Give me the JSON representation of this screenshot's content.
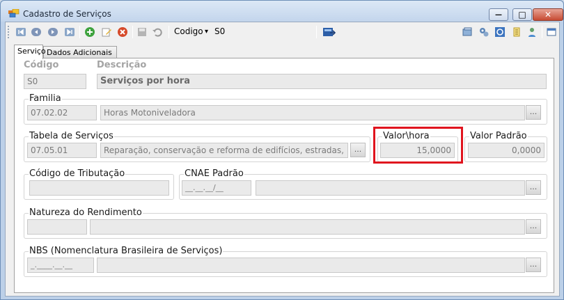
{
  "window": {
    "title": "Cadastro de Serviços",
    "controls": {
      "minimize": "—",
      "maximize": "□",
      "close": "✕"
    }
  },
  "toolbar": {
    "field_label": "Codigo",
    "field_arrow": "▾",
    "field_value": "S0"
  },
  "tabs": [
    {
      "label": "Serviço",
      "active": true
    },
    {
      "label": "Dados Adicionais",
      "active": false
    }
  ],
  "form": {
    "codigo": {
      "label": "Código",
      "value": "S0"
    },
    "descricao": {
      "label": "Descrição",
      "value": "Serviços por hora"
    },
    "familia": {
      "label": "Familia",
      "code": "07.02.02",
      "description": "Horas Motoniveladora"
    },
    "tabela": {
      "label": "Tabela de Serviços",
      "code": "07.05.01",
      "description": "Reparação, conservação e reforma de edifícios, estradas,"
    },
    "valor_hora": {
      "label": "Valor\\hora",
      "value": "15,0000"
    },
    "valor_padrao": {
      "label": "Valor Padrão",
      "value": "0,0000"
    },
    "codigo_tributacao": {
      "label": "Código de Tributação",
      "value": ""
    },
    "cnae": {
      "label": "CNAE Padrão",
      "mask": "__.__.__/__",
      "description": ""
    },
    "natureza": {
      "label": "Natureza do Rendimento",
      "code": "",
      "description": ""
    },
    "nbs": {
      "label": "NBS (Nomenclatura Brasileira de Serviços)",
      "mask": "_.____.__.__",
      "description": ""
    },
    "ellipsis": "..."
  },
  "colors": {
    "highlight": "#e0141e",
    "accent_blue": "#2d5fa8"
  }
}
